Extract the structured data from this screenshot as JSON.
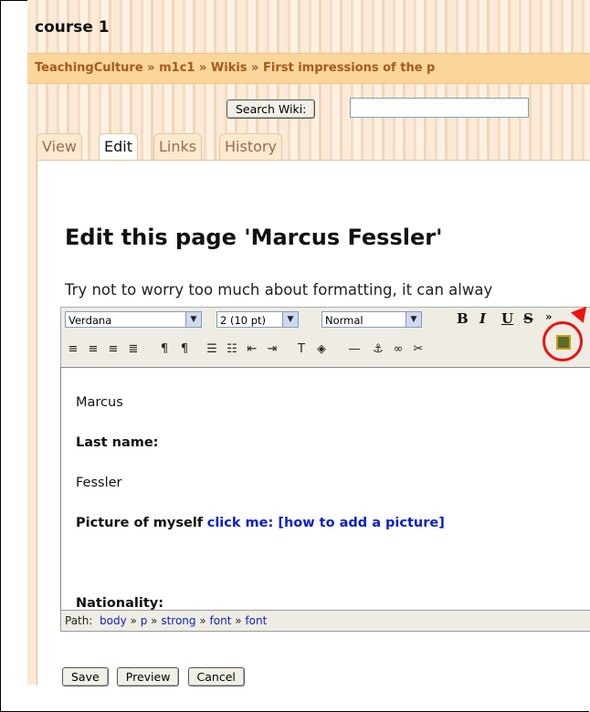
{
  "page": {
    "course_title": "course 1",
    "breadcrumb": "TeachingCulture » m1c1 » Wikis » First impressions of the p"
  },
  "search": {
    "button_label": "Search Wiki:",
    "value": ""
  },
  "tabs": [
    {
      "label": "View"
    },
    {
      "label": "Edit"
    },
    {
      "label": "Links"
    },
    {
      "label": "History"
    }
  ],
  "editor_page": {
    "heading": "Edit this page 'Marcus Fessler'",
    "hint": "Try not to worry too much about formatting, it can alway"
  },
  "toolbar": {
    "font_family": "Verdana",
    "font_size": "2 (10 pt)",
    "format": "Normal",
    "bold": "B",
    "italic": "I",
    "underline": "U",
    "strike": "S",
    "icons": [
      "align-left-icon",
      "align-center-icon",
      "align-right-icon",
      "justify-icon",
      "ltr-icon",
      "rtl-icon",
      "ordered-list-icon",
      "unordered-list-icon",
      "outdent-icon",
      "indent-icon",
      "text-color-icon",
      "background-color-icon",
      "horizontal-rule-icon",
      "anchor-icon",
      "link-icon",
      "unlink-icon",
      "insert-image-icon"
    ]
  },
  "editor_content": {
    "first_name": "Marcus",
    "last_name_label": "Last name:",
    "last_name": "Fessler",
    "picture_label": "Picture of myself",
    "picture_link": "click me: [how to add a picture]",
    "nationality_label": "Nationality:"
  },
  "path": {
    "label": "Path:",
    "items": [
      "body",
      "p",
      "strong",
      "font",
      "font"
    ]
  },
  "actions": {
    "save": "Save",
    "preview": "Preview",
    "cancel": "Cancel"
  },
  "colors": {
    "annotation": "#e11111",
    "breadcrumb_bg": "#fad59c",
    "link": "#0a1fd0"
  }
}
